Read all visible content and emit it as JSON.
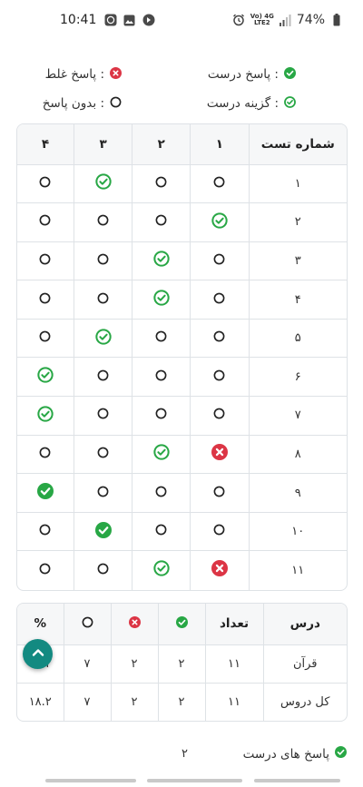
{
  "status_bar": {
    "time": "10:41",
    "left_icons": [
      "whatsapp-icon",
      "gallery-icon",
      "notification-icon"
    ],
    "network_label_top": "Vo) 4G",
    "network_label_bottom": "LTE2",
    "battery": "74%"
  },
  "legend": {
    "correct_answer": " : پاسخ درست",
    "wrong_answer": " : پاسخ غلط",
    "correct_option": " : گزینه درست",
    "no_answer": " : بدون پاسخ"
  },
  "answers_table": {
    "header": {
      "test_number": "شماره تست",
      "options": [
        "۱",
        "۲",
        "۳",
        "۴"
      ]
    },
    "rows": [
      {
        "num": "۱",
        "cells": [
          "empty",
          "empty",
          "option",
          "empty"
        ]
      },
      {
        "num": "۲",
        "cells": [
          "option",
          "empty",
          "empty",
          "empty"
        ]
      },
      {
        "num": "۳",
        "cells": [
          "empty",
          "option",
          "empty",
          "empty"
        ]
      },
      {
        "num": "۴",
        "cells": [
          "empty",
          "option",
          "empty",
          "empty"
        ]
      },
      {
        "num": "۵",
        "cells": [
          "empty",
          "empty",
          "option",
          "empty"
        ]
      },
      {
        "num": "۶",
        "cells": [
          "empty",
          "empty",
          "empty",
          "option"
        ]
      },
      {
        "num": "۷",
        "cells": [
          "empty",
          "empty",
          "empty",
          "option"
        ]
      },
      {
        "num": "۸",
        "cells": [
          "wrong",
          "option",
          "empty",
          "empty"
        ]
      },
      {
        "num": "۹",
        "cells": [
          "empty",
          "empty",
          "empty",
          "correct"
        ]
      },
      {
        "num": "۱۰",
        "cells": [
          "empty",
          "empty",
          "correct",
          "empty"
        ]
      },
      {
        "num": "۱۱",
        "cells": [
          "wrong",
          "option",
          "empty",
          "empty"
        ]
      }
    ]
  },
  "summary_table": {
    "header": {
      "lesson": "درس",
      "count": "تعداد",
      "correct_icon": "correct-icon",
      "wrong_icon": "wrong-icon",
      "empty_icon": "empty-circle-icon",
      "percent": "%"
    },
    "rows": [
      {
        "lesson": "قرآن",
        "count": "۱۱",
        "correct": "۲",
        "wrong": "۲",
        "empty": "۷",
        "percent": "۱۸.۲"
      },
      {
        "lesson": "کل دروس",
        "count": "۱۱",
        "correct": "۲",
        "wrong": "۲",
        "empty": "۷",
        "percent": "۱۸.۲"
      }
    ]
  },
  "bottom": {
    "label": "پاسخ های درست",
    "value": "۲"
  },
  "colors": {
    "green": "#28a745",
    "red": "#dc3545",
    "fab": "#138a81",
    "border": "#dee2e6",
    "header_bg": "#f6f7f8"
  }
}
